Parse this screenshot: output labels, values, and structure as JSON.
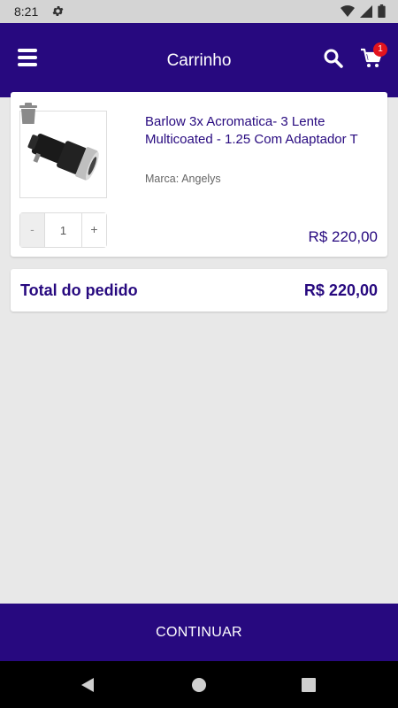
{
  "status_bar": {
    "time": "8:21",
    "icons": [
      "settings-icon",
      "wifi-icon",
      "signal-icon",
      "battery-icon"
    ]
  },
  "app_bar": {
    "title": "Carrinho",
    "icons": [
      "menu-icon",
      "search-icon",
      "cart-icon"
    ],
    "cart_badge": "1",
    "color": "#27097f",
    "badge_color": "#e3141d"
  },
  "cart": {
    "items": [
      {
        "title": "Barlow 3x Acromatica-  3 Lente Multicoated - 1.25 Com Adaptador T",
        "brand_label": "Marca:",
        "brand": "Angelys",
        "quantity": "1",
        "minus_label": "-",
        "plus_label": "+",
        "price": "R$ 220,00",
        "image": "barlow-lens-photo"
      }
    ],
    "total_label": "Total do pedido",
    "total_value": "R$ 220,00"
  },
  "footer": {
    "continue_label": "CONTINUAR"
  },
  "nav_bar": {
    "icons": [
      "back-icon",
      "home-icon",
      "recents-icon"
    ]
  }
}
